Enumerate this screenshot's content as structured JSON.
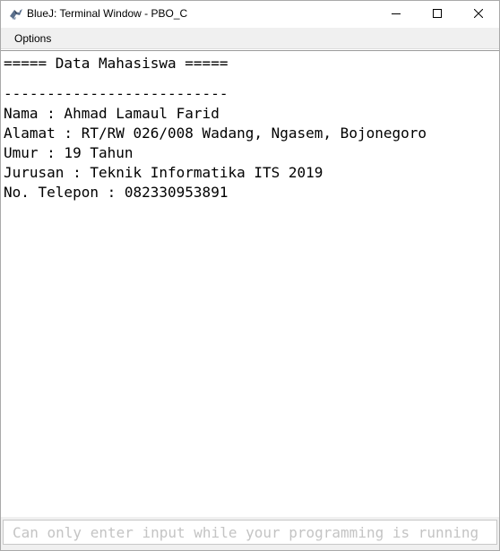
{
  "window": {
    "title": "BlueJ: Terminal Window - PBO_C"
  },
  "menu": {
    "options_label": "Options"
  },
  "terminal": {
    "lines": [
      "===== Data Mahasiswa =====",
      "",
      "--------------------------",
      "Nama : Ahmad Lamaul Farid",
      "Alamat : RT/RW 026/008 Wadang, Ngasem, Bojonegoro",
      "Umur : 19 Tahun",
      "Jurusan : Teknik Informatika ITS 2019",
      "No. Telepon : 082330953891"
    ]
  },
  "input": {
    "placeholder": "Can only enter input while your programming is running"
  },
  "icons": {
    "app": "bluej-bird-icon",
    "minimize": "minimize-icon",
    "maximize": "maximize-icon",
    "close": "close-icon"
  }
}
